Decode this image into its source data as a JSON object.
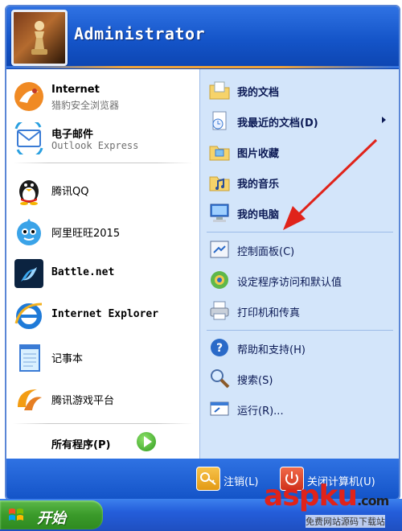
{
  "header": {
    "username": "Administrator"
  },
  "pinned": [
    {
      "title": "Internet",
      "subtitle": "猎豹安全浏览器"
    },
    {
      "title": "电子邮件",
      "subtitle": "Outlook Express"
    }
  ],
  "recent": [
    {
      "label": "腾讯QQ"
    },
    {
      "label": "阿里旺旺2015"
    },
    {
      "label": "Battle.net"
    },
    {
      "label": "Internet Explorer"
    },
    {
      "label": "记事本"
    },
    {
      "label": "腾讯游戏平台"
    }
  ],
  "all_programs": {
    "label": "所有程序(P)"
  },
  "places": [
    {
      "label": "我的文档",
      "icon": "documents-folder-icon"
    },
    {
      "label": "我最近的文档(D)",
      "icon": "recent-documents-icon",
      "has_submenu": true
    },
    {
      "label": "图片收藏",
      "icon": "pictures-folder-icon"
    },
    {
      "label": "我的音乐",
      "icon": "music-folder-icon"
    },
    {
      "label": "我的电脑",
      "icon": "computer-icon"
    }
  ],
  "system": [
    {
      "label": "控制面板(C)",
      "icon": "control-panel-icon"
    },
    {
      "label": "设定程序访问和默认值",
      "icon": "program-defaults-icon"
    },
    {
      "label": "打印机和传真",
      "icon": "printer-icon"
    }
  ],
  "help": [
    {
      "label": "帮助和支持(H)",
      "icon": "help-icon"
    },
    {
      "label": "搜索(S)",
      "icon": "search-icon"
    },
    {
      "label": "运行(R)...",
      "icon": "run-icon"
    }
  ],
  "footer": {
    "logoff_label": "注销(L)",
    "shutdown_label": "关闭计算机(U)"
  },
  "taskbar": {
    "start_label": "开始"
  },
  "watermark": {
    "brand": "aspku",
    "suffix": ".com",
    "caption": "免费网站源码下载站"
  },
  "colors": {
    "header_blue": "#1454c8",
    "right_panel": "#d3e5fa",
    "start_green": "#3a9a2a",
    "annotation_arrow": "#e0231a"
  }
}
